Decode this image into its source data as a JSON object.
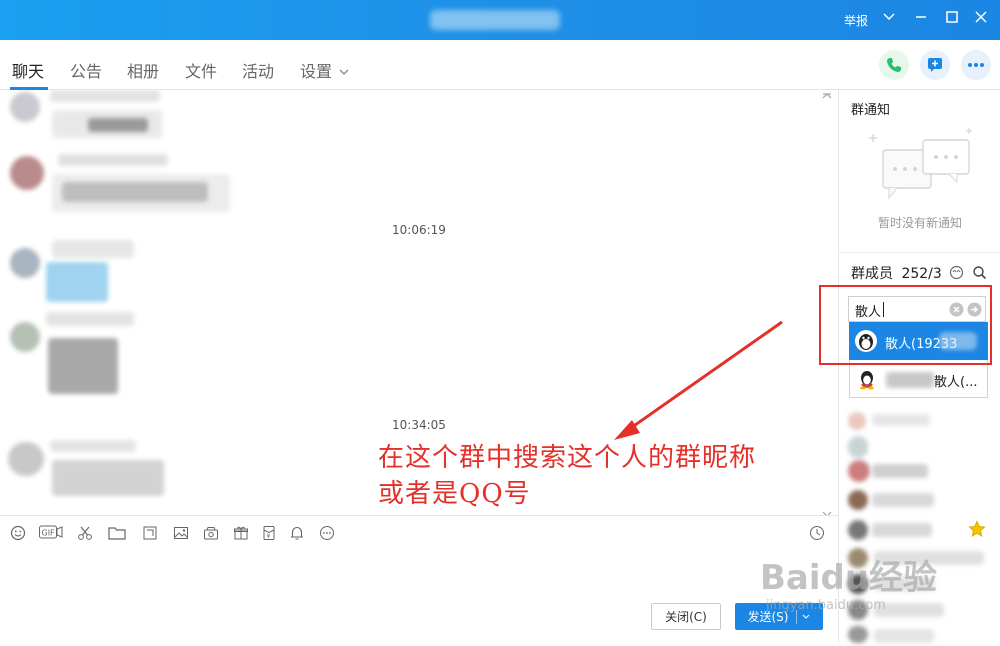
{
  "window": {
    "report_label": "举报",
    "controls": [
      "chevron-down-icon",
      "minimize-icon",
      "maximize-icon",
      "close-icon"
    ]
  },
  "tabs": [
    {
      "label": "聊天",
      "active": true
    },
    {
      "label": "公告"
    },
    {
      "label": "相册"
    },
    {
      "label": "文件"
    },
    {
      "label": "活动"
    },
    {
      "label": "设置"
    }
  ],
  "chat": {
    "timestamps": [
      "10:06:19",
      "10:34:05"
    ],
    "annotation_line1": "在这个群中搜索这个人的群昵称",
    "annotation_line2": "或者是QQ号"
  },
  "sidebar": {
    "notice_title": "群通知",
    "notice_empty": "暂时没有新通知",
    "members_label": "群成员",
    "members_count": "252/3",
    "search_value": "散人",
    "results": [
      {
        "label": "散人(19233",
        "selected": true
      },
      {
        "label": "散人(..."
      }
    ]
  },
  "composer": {
    "close_label": "关闭(C)",
    "send_label": "发送(S)"
  },
  "watermark": {
    "brand": "Baidu经验",
    "url": "jingyan.baidu.com"
  },
  "colors": {
    "accent": "#1b86e3",
    "annotation": "#e5302a",
    "phone": "#2bbf6b"
  }
}
